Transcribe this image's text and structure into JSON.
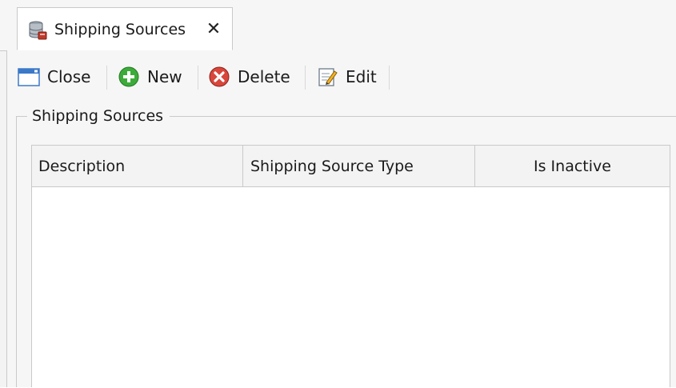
{
  "tab": {
    "title": "Shipping Sources",
    "icon": "database-icon",
    "close_glyph": "✕"
  },
  "toolbar": {
    "close_label": "Close",
    "new_label": "New",
    "delete_label": "Delete",
    "edit_label": "Edit"
  },
  "group": {
    "title": "Shipping Sources"
  },
  "grid": {
    "columns": [
      "Description",
      "Shipping Source Type",
      "Is Inactive"
    ],
    "rows": []
  },
  "colors": {
    "new_green": "#3dab3a",
    "delete_red": "#d9463c",
    "close_blue": "#3b78c8",
    "border": "#c9c9c9"
  }
}
